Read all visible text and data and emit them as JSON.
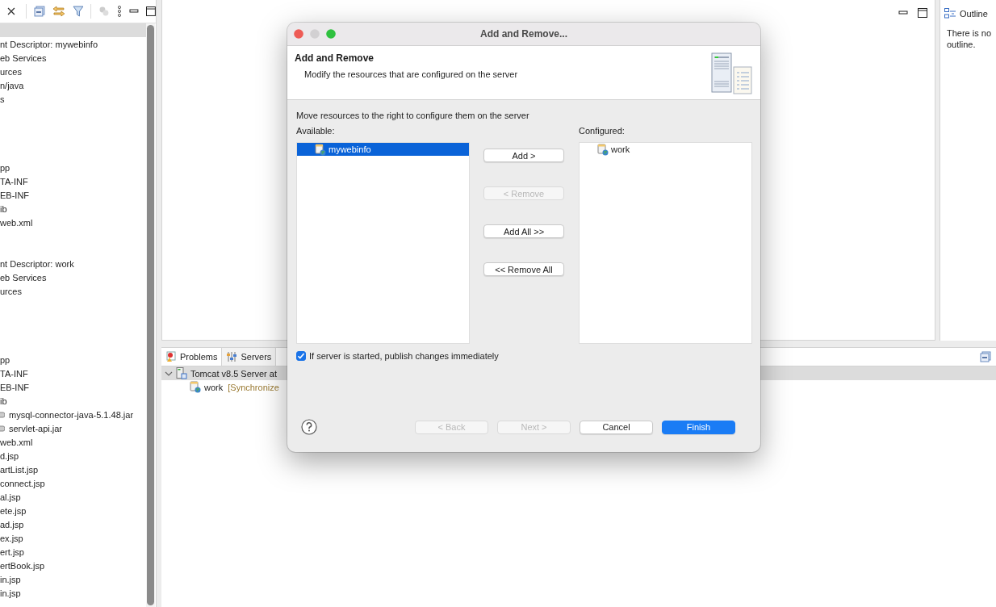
{
  "explorer": {
    "rows": [
      {
        "kind": "blank",
        "text": "",
        "selected": true
      },
      {
        "kind": "file",
        "text": "nt Descriptor: mywebinfo",
        "selected": false
      },
      {
        "kind": "file",
        "text": "eb Services",
        "selected": false
      },
      {
        "kind": "file",
        "text": "urces",
        "selected": false
      },
      {
        "kind": "file",
        "text": "n/java",
        "selected": false
      },
      {
        "kind": "file",
        "text": "s",
        "selected": false
      },
      {
        "kind": "blank",
        "text": "",
        "selected": false
      },
      {
        "kind": "blank",
        "text": "",
        "selected": false
      },
      {
        "kind": "blank",
        "text": "",
        "selected": false
      },
      {
        "kind": "blank",
        "text": "",
        "selected": false
      },
      {
        "kind": "file",
        "text": "pp",
        "selected": false
      },
      {
        "kind": "file",
        "text": "TA-INF",
        "selected": false
      },
      {
        "kind": "file",
        "text": "EB-INF",
        "selected": false
      },
      {
        "kind": "file",
        "text": "ib",
        "selected": false
      },
      {
        "kind": "file",
        "text": "web.xml",
        "selected": false
      },
      {
        "kind": "blank",
        "text": "",
        "selected": false
      },
      {
        "kind": "blank",
        "text": "",
        "selected": false
      },
      {
        "kind": "file",
        "text": "nt Descriptor: work",
        "selected": false
      },
      {
        "kind": "file",
        "text": "eb Services",
        "selected": false
      },
      {
        "kind": "file",
        "text": "urces",
        "selected": false
      },
      {
        "kind": "blank",
        "text": "",
        "selected": false
      },
      {
        "kind": "blank",
        "text": "",
        "selected": false
      },
      {
        "kind": "blank",
        "text": "",
        "selected": false
      },
      {
        "kind": "blank",
        "text": "",
        "selected": false
      },
      {
        "kind": "file",
        "text": "pp",
        "selected": false
      },
      {
        "kind": "file",
        "text": "TA-INF",
        "selected": false
      },
      {
        "kind": "file",
        "text": "EB-INF",
        "selected": false
      },
      {
        "kind": "file",
        "text": "ib",
        "selected": false
      },
      {
        "kind": "jar",
        "text": "mysql-connector-java-5.1.48.jar",
        "selected": false
      },
      {
        "kind": "jar",
        "text": "servlet-api.jar",
        "selected": false
      },
      {
        "kind": "file",
        "text": "web.xml",
        "selected": false
      },
      {
        "kind": "file",
        "text": "d.jsp",
        "selected": false
      },
      {
        "kind": "file",
        "text": "artList.jsp",
        "selected": false
      },
      {
        "kind": "file",
        "text": "connect.jsp",
        "selected": false
      },
      {
        "kind": "file",
        "text": "al.jsp",
        "selected": false
      },
      {
        "kind": "file",
        "text": "ete.jsp",
        "selected": false
      },
      {
        "kind": "file",
        "text": "ad.jsp",
        "selected": false
      },
      {
        "kind": "file",
        "text": "ex.jsp",
        "selected": false
      },
      {
        "kind": "file",
        "text": "ert.jsp",
        "selected": false
      },
      {
        "kind": "file",
        "text": "ertBook.jsp",
        "selected": false
      },
      {
        "kind": "file",
        "text": "in.jsp",
        "selected": false
      },
      {
        "kind": "file",
        "text": "in.jsp",
        "selected": false
      }
    ]
  },
  "outline": {
    "tab": "Outline",
    "message": "There is no outline."
  },
  "bottom": {
    "tabs": [
      {
        "label": "Problems",
        "selected": true
      },
      {
        "label": "Servers",
        "selected": false
      }
    ],
    "tree": [
      {
        "label": "Tomcat v8.5 Server at",
        "expanded": true,
        "selected": true,
        "children": [
          {
            "label": "work",
            "status": "[Synchronize"
          }
        ]
      }
    ]
  },
  "dialog": {
    "title": "Add and Remove...",
    "heading": "Add and Remove",
    "subheading": "Modify the resources that are configured on the server",
    "instruction": "Move resources to the right to configure them on the server",
    "available": {
      "label": "Available:",
      "items": [
        {
          "label": "mywebinfo",
          "selected": true
        }
      ]
    },
    "configured": {
      "label": "Configured:",
      "items": [
        {
          "label": "work",
          "selected": false
        }
      ]
    },
    "moves": [
      {
        "label": "Add >",
        "disabled": false
      },
      {
        "label": "< Remove",
        "disabled": true
      },
      {
        "label": "Add All >>",
        "disabled": false
      },
      {
        "label": "<< Remove All",
        "disabled": false
      }
    ],
    "publish": {
      "label": "If server is started, publish changes immediately",
      "checked": true
    },
    "buttons": [
      {
        "label": "< Back",
        "disabled": true,
        "default": false
      },
      {
        "label": "Next >",
        "disabled": true,
        "default": false
      },
      {
        "label": "Cancel",
        "disabled": false,
        "default": false
      },
      {
        "label": "Finish",
        "disabled": false,
        "default": true
      }
    ]
  }
}
